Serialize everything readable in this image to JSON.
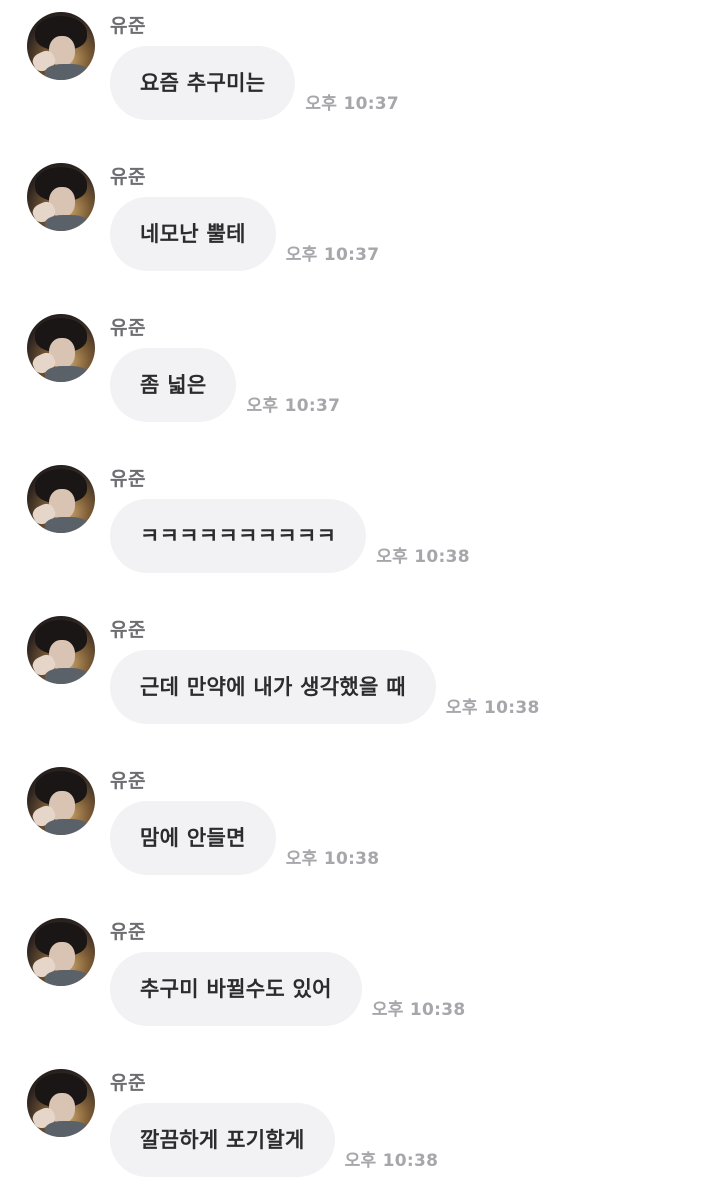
{
  "messages": [
    {
      "sender": "유준",
      "text": "요즘 추구미는",
      "time": "오후 10:37"
    },
    {
      "sender": "유준",
      "text": "네모난 뿔테",
      "time": "오후 10:37"
    },
    {
      "sender": "유준",
      "text": "좀 넓은",
      "time": "오후 10:37"
    },
    {
      "sender": "유준",
      "text": "ㅋㅋㅋㅋㅋㅋㅋㅋㅋㅋ",
      "time": "오후 10:38"
    },
    {
      "sender": "유준",
      "text": "근데 만약에 내가 생각했을 때",
      "time": "오후 10:38"
    },
    {
      "sender": "유준",
      "text": "맘에 안들면",
      "time": "오후 10:38"
    },
    {
      "sender": "유준",
      "text": "추구미 바뀔수도 있어",
      "time": "오후 10:38"
    },
    {
      "sender": "유준",
      "text": "깔끔하게 포기할게",
      "time": "오후 10:38"
    }
  ],
  "icons": {
    "avatar": "user-avatar-photo"
  }
}
